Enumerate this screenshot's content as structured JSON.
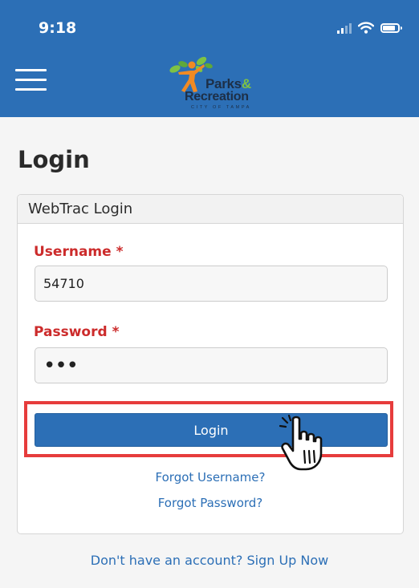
{
  "status_bar": {
    "time": "9:18"
  },
  "header": {
    "logo_text_parks": "Parks",
    "logo_text_amp": "&",
    "logo_text_recreation": "Recreation",
    "logo_text_city": "CITY OF TAMPA",
    "background_color": "#2c6fb6"
  },
  "page": {
    "title": "Login"
  },
  "login_panel": {
    "heading": "WebTrac Login",
    "username_label": "Username *",
    "username_value": "54710",
    "password_label": "Password *",
    "password_value": "•••",
    "login_button": "Login",
    "forgot_username": "Forgot Username?",
    "forgot_password": "Forgot Password?"
  },
  "footer": {
    "signup_link": "Don't have an account? Sign Up Now"
  },
  "colors": {
    "accent": "#2c6fb6",
    "required_label": "#cc2b2b",
    "highlight": "#e63c3c"
  },
  "icons": {
    "menu": "hamburger-menu-icon",
    "cursor": "hand-pointer-icon"
  }
}
